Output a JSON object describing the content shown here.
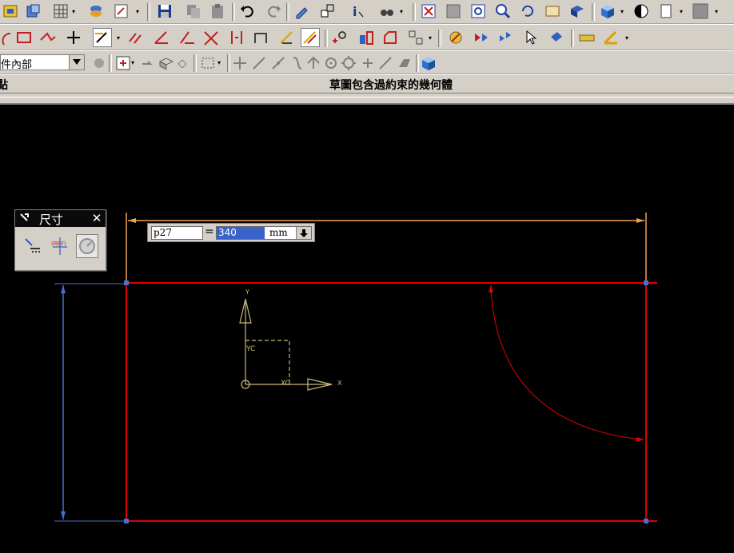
{
  "filter": {
    "value": "件內部"
  },
  "status": {
    "left": "點",
    "message": "草圖包含過約束的幾何體"
  },
  "dimension_panel": {
    "title": "尺寸",
    "close_glyph": "✕"
  },
  "expression": {
    "name": "p27",
    "equals": "=",
    "value": "340",
    "unit": "mm"
  },
  "axes": {
    "x": "X",
    "y": "Y",
    "xc": "XC",
    "yc": "YC"
  },
  "colors": {
    "sketch": "#e00000",
    "dim_horizontal": "#f0a050",
    "dim_vertical": "#4a6fd0",
    "csys": "#c8b87a",
    "toolbar": "#d4d0c8"
  }
}
